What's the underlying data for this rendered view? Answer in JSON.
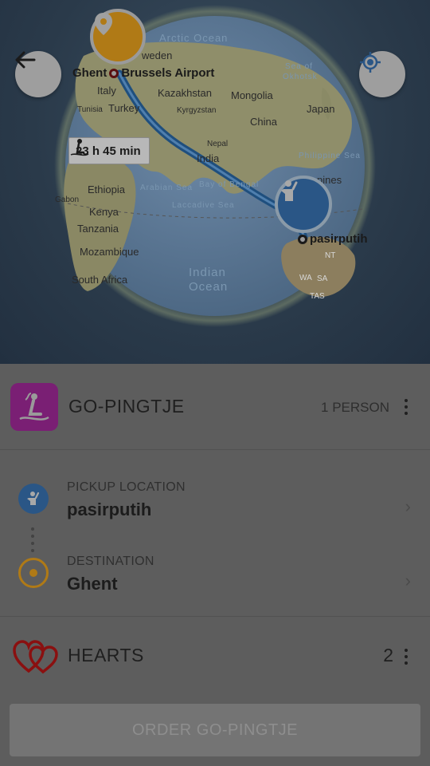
{
  "map": {
    "oceans": [
      "Arctic Ocean",
      "Indian",
      "Ocean",
      "Arabian Sea",
      "Bay of Bengal",
      "Laccadive Sea",
      "Philippine Sea",
      "Sea of",
      "Okhotsk"
    ],
    "places": {
      "sweden": "weden",
      "italy": "Italy",
      "tunisia": "Tunisia",
      "turkey": "Turkey",
      "kazakhstan": "Kazakhstan",
      "mongolia": "Mongolia",
      "kyrgyzstan": "Kyrgyzstan",
      "china": "China",
      "japan": "Japan",
      "nepal": "Nepal",
      "india": "India",
      "ethiopia": "Ethiopia",
      "gabon": "Gabon",
      "kenya": "Kenya",
      "tanzania": "Tanzania",
      "mozambique": "Mozambique",
      "south_africa": "South Africa",
      "pines": "pines",
      "nt": "NT",
      "wa": "WA",
      "sa": "SA",
      "tas": "TAS"
    },
    "origin_label": "Ghent",
    "airport_label": "Brussels Airport",
    "pickup_label": "pasirputih",
    "travel_time": "23 h 45 min",
    "back_icon": "arrow-left-icon",
    "locate_icon": "crosshair-icon"
  },
  "service": {
    "name": "GO-PINGTJE",
    "persons": "1 PERSON",
    "icon": "meditation-icon",
    "icon_color": "#7a1f74"
  },
  "pickup": {
    "caption": "PICKUP LOCATION",
    "value": "pasirputih",
    "icon_color": "#2a5686"
  },
  "destination": {
    "caption": "DESTINATION",
    "value": "Ghent",
    "icon_color": "#b07a16"
  },
  "hearts": {
    "label": "HEARTS",
    "count": "2",
    "icon_color": "#8a1010"
  },
  "order": {
    "label": "ORDER GO-PINGTJE"
  }
}
